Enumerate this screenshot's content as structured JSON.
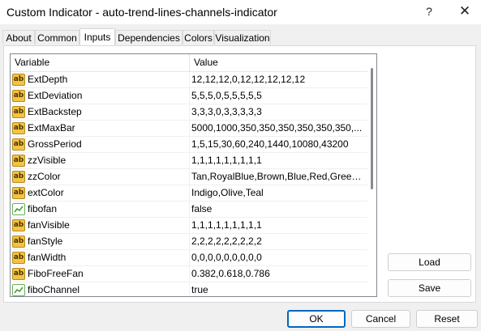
{
  "window": {
    "title": "Custom Indicator - auto-trend-lines-channels-indicator",
    "help_glyph": "?",
    "close_glyph": "✕"
  },
  "tabs": [
    {
      "label": "About",
      "active": false
    },
    {
      "label": "Common",
      "active": false
    },
    {
      "label": "Inputs",
      "active": true
    },
    {
      "label": "Dependencies",
      "active": false
    },
    {
      "label": "Colors",
      "active": false
    },
    {
      "label": "Visualization",
      "active": false
    }
  ],
  "grid": {
    "columns": {
      "variable": "Variable",
      "value": "Value"
    },
    "rows": [
      {
        "icon": "ab-string-icon",
        "icon_text": "ab",
        "name": "ExtDepth",
        "value": "12,12,12,0,12,12,12,12,12"
      },
      {
        "icon": "ab-string-icon",
        "icon_text": "ab",
        "name": "ExtDeviation",
        "value": "5,5,5,0,5,5,5,5,5"
      },
      {
        "icon": "ab-string-icon",
        "icon_text": "ab",
        "name": "ExtBackstep",
        "value": "3,3,3,0,3,3,3,3,3"
      },
      {
        "icon": "ab-string-icon",
        "icon_text": "ab",
        "name": "ExtMaxBar",
        "value": "5000,1000,350,350,350,350,350,350,..."
      },
      {
        "icon": "ab-string-icon",
        "icon_text": "ab",
        "name": "GrossPeriod",
        "value": "1,5,15,30,60,240,1440,10080,43200"
      },
      {
        "icon": "ab-string-icon",
        "icon_text": "ab",
        "name": "zzVisible",
        "value": "1,1,1,1,1,1,1,1,1"
      },
      {
        "icon": "ab-string-icon",
        "icon_text": "ab",
        "name": "zzColor",
        "value": "Tan,RoyalBlue,Brown,Blue,Red,GreenYell..."
      },
      {
        "icon": "ab-string-icon",
        "icon_text": "ab",
        "name": "extColor",
        "value": "Indigo,Olive,Teal"
      },
      {
        "icon": "bool-icon",
        "icon_text": "",
        "name": "fibofan",
        "value": "false"
      },
      {
        "icon": "ab-string-icon",
        "icon_text": "ab",
        "name": "fanVisible",
        "value": "1,1,1,1,1,1,1,1,1"
      },
      {
        "icon": "ab-string-icon",
        "icon_text": "ab",
        "name": "fanStyle",
        "value": "2,2,2,2,2,2,2,2,2"
      },
      {
        "icon": "ab-string-icon",
        "icon_text": "ab",
        "name": "fanWidth",
        "value": "0,0,0,0,0,0,0,0,0"
      },
      {
        "icon": "ab-string-icon",
        "icon_text": "ab",
        "name": "FiboFreeFan",
        "value": "0.382,0.618,0.786"
      },
      {
        "icon": "bool-icon",
        "icon_text": "",
        "name": "fiboChannel",
        "value": "true"
      }
    ]
  },
  "side_buttons": {
    "load": "Load",
    "save": "Save"
  },
  "footer_buttons": {
    "ok": "OK",
    "cancel": "Cancel",
    "reset": "Reset"
  },
  "colors": {
    "accent": "#0067c0",
    "string_icon": "#f3c442",
    "bool_icon": "#6aaf5a"
  }
}
